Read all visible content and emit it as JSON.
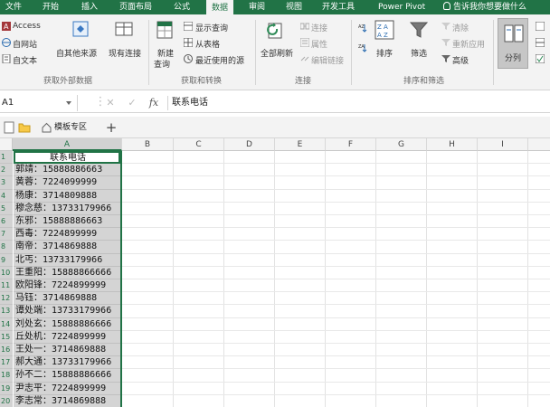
{
  "tabs": [
    "文件",
    "开始",
    "插入",
    "页面布局",
    "公式",
    "数据",
    "审阅",
    "视图",
    "开发工具",
    "Power Pivot"
  ],
  "active_tab": "数据",
  "tell_me": "告诉我你想要做什么",
  "ribbon": {
    "get_external": {
      "access": "Access",
      "web": "自网站",
      "text": "自文本",
      "other_sources": "自其他来源",
      "existing": "现有连接",
      "label": "获取外部数据"
    },
    "transform": {
      "new_query": "新建",
      "new_query_2": "查询",
      "show_queries": "显示查询",
      "from_table": "从表格",
      "recent": "最近使用的源",
      "label": "获取和转换"
    },
    "connections": {
      "refresh_all": "全部刷新",
      "connections": "连接",
      "properties": "属性",
      "edit_links": "编辑链接",
      "label": "连接"
    },
    "sort_filter": {
      "sort": "排序",
      "filter": "筛选",
      "clear": "清除",
      "reapply": "重新应用",
      "advanced": "高级",
      "label": "排序和筛选"
    },
    "tools": {
      "split": "分列"
    }
  },
  "formula_bar": {
    "name_box": "A1",
    "cancel": "✕",
    "enter": "✓",
    "fx": "fx",
    "value": "联系电话"
  },
  "workbook": {
    "template_tab": "模板专区",
    "add": "+"
  },
  "sheet": {
    "columns": [
      "A",
      "B",
      "C",
      "D",
      "E",
      "F",
      "G",
      "H",
      "I"
    ],
    "rows": [
      "1",
      "2",
      "3",
      "4",
      "5",
      "6",
      "7",
      "8",
      "9",
      "10",
      "11",
      "12",
      "13",
      "14",
      "15",
      "16",
      "17",
      "18",
      "19",
      "20"
    ],
    "header_cell": "联系电话",
    "cells": [
      "郭靖：15888886663",
      "黄蓉：7224099999",
      "杨康：3714809888",
      "穆念慈：13733179966",
      "东邪：15888886663",
      "西毒：7224899999",
      "南帝：3714869888",
      "北丐：13733179966",
      "王重阳：15888866666",
      "欧阳锋：7224899999",
      "马钰：3714869888",
      "谭处端：13733179966",
      "刘处玄：15888886666",
      "丘处机：7224899999",
      "王处一：3714869888",
      "郝大通：13733179966",
      "孙不二：15888886666",
      "尹志平：7224899999",
      "李志常：3714869888"
    ]
  },
  "colors": {
    "accent": "#217346",
    "selection": "#d4d4d4"
  }
}
